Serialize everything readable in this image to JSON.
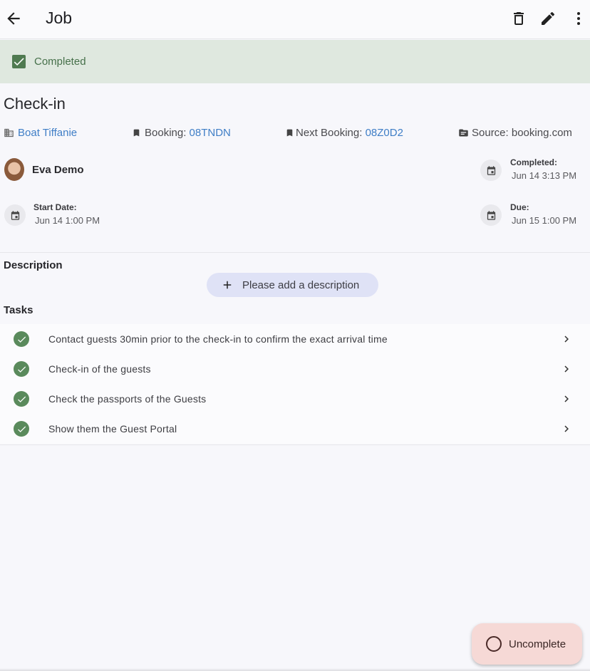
{
  "appbar": {
    "title": "Job",
    "icons": [
      "back-arrow-icon",
      "delete-icon",
      "edit-icon",
      "more-vert-icon"
    ]
  },
  "status": {
    "label": "Completed",
    "color": "#46704a"
  },
  "job": {
    "title": "Check-in",
    "property": "Boat Tiffanie",
    "booking_label": "Booking: ",
    "booking_code": "08TNDN",
    "next_booking_label": "Next Booking: ",
    "next_booking_code": "08Z0D2",
    "source": "Source: booking.com"
  },
  "assignee": {
    "name": "Eva Demo"
  },
  "dates": {
    "completed_label": "Completed:",
    "completed_value": "Jun 14 3:13 PM",
    "start_label": "Start Date:",
    "start_value": "Jun 14 1:00 PM",
    "due_label": "Due:",
    "due_value": "Jun 15 1:00 PM"
  },
  "description": {
    "heading": "Description",
    "add_button": "Please add a description"
  },
  "tasks": {
    "heading": "Tasks",
    "items": [
      {
        "label": "Contact guests 30min prior to the check-in to confirm the exact arrival time",
        "done": true
      },
      {
        "label": "Check-in of the guests",
        "done": true
      },
      {
        "label": "Check the passports of the Guests",
        "done": true
      },
      {
        "label": "Show them the Guest Portal",
        "done": true
      }
    ]
  },
  "fab": {
    "label": "Uncomplete"
  },
  "colors": {
    "link": "#3f7ec6",
    "accent_green": "#5a8a5c",
    "banner_bg": "#dfe8df",
    "fab_bg": "#f6d9d6"
  }
}
